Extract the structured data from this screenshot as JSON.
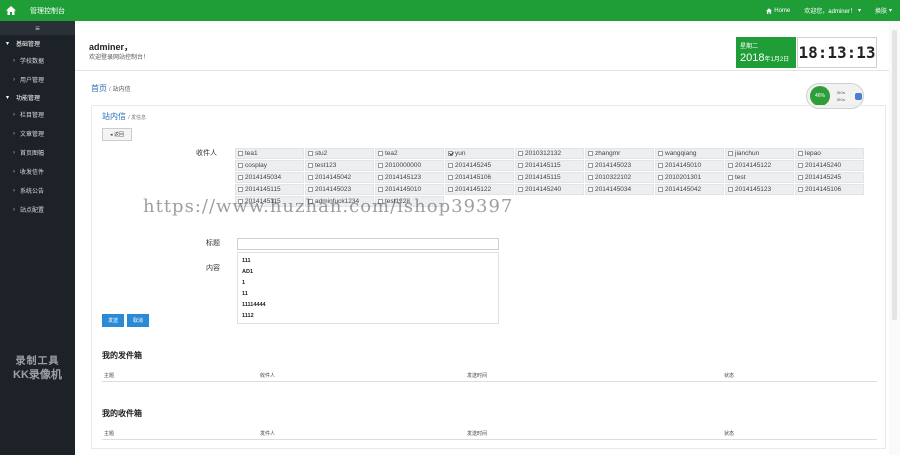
{
  "topbar": {
    "app_title": "管理控制台",
    "home_link": "Home",
    "welcome_user": "欢迎您，adminer！",
    "theme": "换肤"
  },
  "sidebar": {
    "groups": [
      {
        "label": "基础管理",
        "items": [
          "学校数据",
          "用户管理"
        ]
      },
      {
        "label": "功能管理",
        "items": [
          "栏目管理",
          "文章管理",
          "首页图幅",
          "收发信件",
          "系统公告",
          "站点配置"
        ]
      }
    ],
    "watermark_line1": "录制工具",
    "watermark_line2": "KK录像机"
  },
  "header": {
    "user": "adminer，",
    "welcome": "欢迎登录网站控制台！",
    "weekday": "星期二",
    "year": "2018",
    "month_day": "年1月2日",
    "time": "18:13:13"
  },
  "breadcrumb": {
    "home": "首页",
    "separator": "/",
    "current": "站内信"
  },
  "net_widget": {
    "percent": "46%",
    "up": "0K/s",
    "down": "0K/s"
  },
  "panel": {
    "title": "站内信",
    "subtitle": "发信息",
    "back_label": "返回",
    "recipients_label": "收件人",
    "subject_label": "标题",
    "content_label": "内容",
    "recipients": [
      "tea1",
      "stu2",
      "tea2",
      "yun",
      "2010312132",
      "zhangmr",
      "wangqiang",
      "jianchun",
      "lepao",
      "cosplay",
      "test123",
      "2010000000",
      "2014145245",
      "2014145115",
      "2014145023",
      "2014145010",
      "2014145122",
      "2014145240",
      "2014145034",
      "2014145042",
      "2014145123",
      "2014145106",
      "2014145115",
      "2010322102",
      "2010201301",
      "test",
      "2014145245",
      "2014145115",
      "2014145023",
      "2014145010",
      "2014145122",
      "2014145240",
      "2014145034",
      "2014145042",
      "2014145123",
      "2014145106",
      "2014145115",
      "adminfuck1234",
      "test1228"
    ],
    "checked_index": 3,
    "content_lines": [
      "111",
      "AD1",
      "1",
      "11",
      "11114444",
      "1112"
    ],
    "send_label": "发送",
    "cancel_label": "取消",
    "outbox_title": "我的发件箱",
    "outbox_cols": [
      "主题",
      "收件人",
      "发送时间",
      "状态"
    ],
    "inbox_title": "我的收件箱",
    "inbox_cols": [
      "主题",
      "发件人",
      "发送时间",
      "状态"
    ]
  },
  "overlay_watermark": "https://www.huzhan.com/ishop39397"
}
